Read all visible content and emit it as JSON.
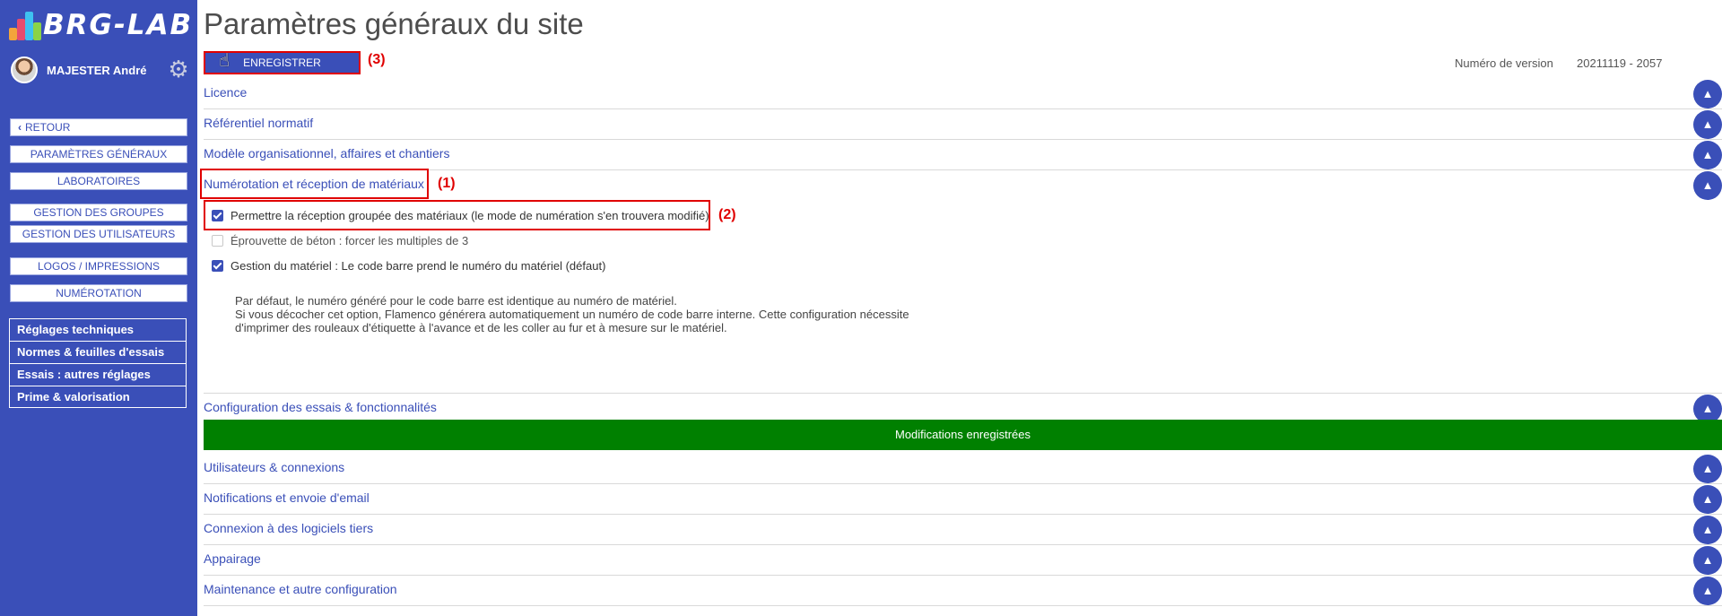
{
  "brand": {
    "name": "BRG-LAB"
  },
  "user": {
    "name": "MAJESTER André"
  },
  "sidebar": {
    "back_label": "RETOUR",
    "nav_items": [
      {
        "label": "PARAMÈTRES GÉNÉRAUX"
      },
      {
        "label": "LABORATOIRES"
      },
      {
        "label": "GESTION DES GROUPES"
      },
      {
        "label": "GESTION DES UTILISATEURS"
      },
      {
        "label": "LOGOS / IMPRESSIONS"
      },
      {
        "label": "NUMÉROTATION"
      }
    ],
    "tech_items": [
      {
        "label": "Réglages techniques"
      },
      {
        "label": "Normes & feuilles d'essais"
      },
      {
        "label": "Essais : autres réglages"
      },
      {
        "label": "Prime & valorisation"
      }
    ]
  },
  "main": {
    "title": "Paramètres généraux du site",
    "save_label": "ENREGISTRER",
    "version_label": "Numéro de version",
    "version_value": "20211119 - 2057",
    "annotations": [
      "(1)",
      "(2)",
      "(3)"
    ],
    "toggle_glyph": "▲",
    "sections": [
      {
        "title": "Licence"
      },
      {
        "title": "Référentiel normatif"
      },
      {
        "title": "Modèle organisationnel, affaires et chantiers"
      },
      {
        "title": "Numérotation et réception de matériaux"
      },
      {
        "title": "Configuration des essais & fonctionnalités"
      },
      {
        "title": "Utilisateurs & connexions"
      },
      {
        "title": "Notifications et envoie d'email"
      },
      {
        "title": "Connexion à des logiciels tiers"
      },
      {
        "title": "Appairage"
      },
      {
        "title": "Maintenance et autre configuration"
      }
    ],
    "options": [
      {
        "label": "Permettre la réception groupée des matériaux (le mode de numération s'en trouvera modifié)",
        "checked": true
      },
      {
        "label": "Éprouvette de béton : forcer les multiples de 3",
        "checked": false
      },
      {
        "label": "Gestion du matériel : Le code barre prend le numéro du matériel (défaut)",
        "checked": true
      }
    ],
    "description": [
      "Par défaut, le numéro généré pour le code barre est identique au numéro de matériel.",
      "Si vous décocher cet option, Flamenco générera automatiquement un numéro de code barre interne. Cette configuration nécessite",
      "d'imprimer des rouleaux d'étiquette à l'avance et de les coller au fur et à mesure sur le matériel."
    ],
    "success_message": "Modifications enregistrées"
  },
  "colors": {
    "sidebar_bg": "#3a4fb8",
    "accent": "#3a4fb8",
    "annotation": "#e00000",
    "success": "#008000"
  }
}
